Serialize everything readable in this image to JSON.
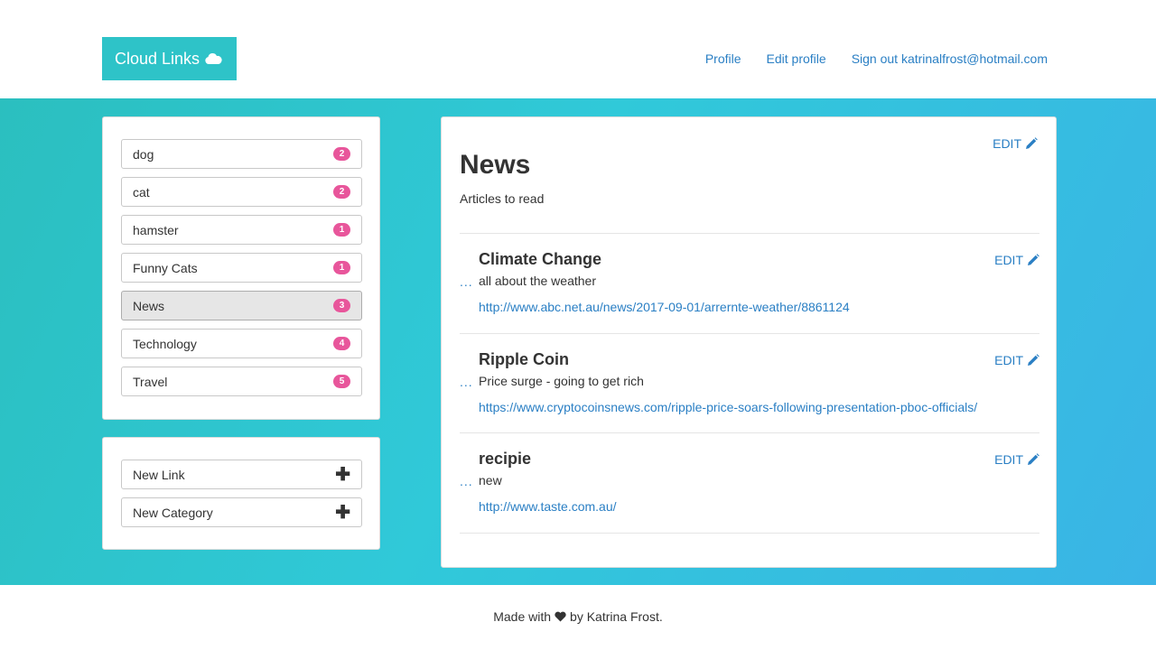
{
  "brand": {
    "title": "Cloud Links",
    "icon": "cloud-icon"
  },
  "nav": {
    "profile": "Profile",
    "edit_profile": "Edit profile",
    "sign_out": "Sign out katrinalfrost@hotmail.com"
  },
  "categories": [
    {
      "label": "dog",
      "count": "2"
    },
    {
      "label": "cat",
      "count": "2"
    },
    {
      "label": "hamster",
      "count": "1"
    },
    {
      "label": "Funny Cats",
      "count": "1"
    },
    {
      "label": "News",
      "count": "3",
      "active": true
    },
    {
      "label": "Technology",
      "count": "4"
    },
    {
      "label": "Travel",
      "count": "5"
    }
  ],
  "actions": {
    "new_link": "New Link",
    "new_category": "New Category"
  },
  "main": {
    "title": "News",
    "description": "Articles to read",
    "edit_label": "EDIT",
    "links": [
      {
        "title": "Climate Change",
        "description": "all about the weather",
        "url": "http://www.abc.net.au/news/2017-09-01/arrernte-weather/8861124",
        "menu": "..."
      },
      {
        "title": "Ripple Coin",
        "description": "Price surge - going to get rich",
        "url": "https://www.cryptocoinsnews.com/ripple-price-soars-following-presentation-pboc-officials/",
        "menu": "..."
      },
      {
        "title": "recipie",
        "description": "new",
        "url": "http://www.taste.com.au/",
        "menu": "..."
      }
    ]
  },
  "footer": {
    "prefix": "Made with",
    "suffix": "by Katrina Frost."
  },
  "colors": {
    "brand": "#2ec3c8",
    "link": "#2a7fc4",
    "badge": "#e8569b"
  }
}
